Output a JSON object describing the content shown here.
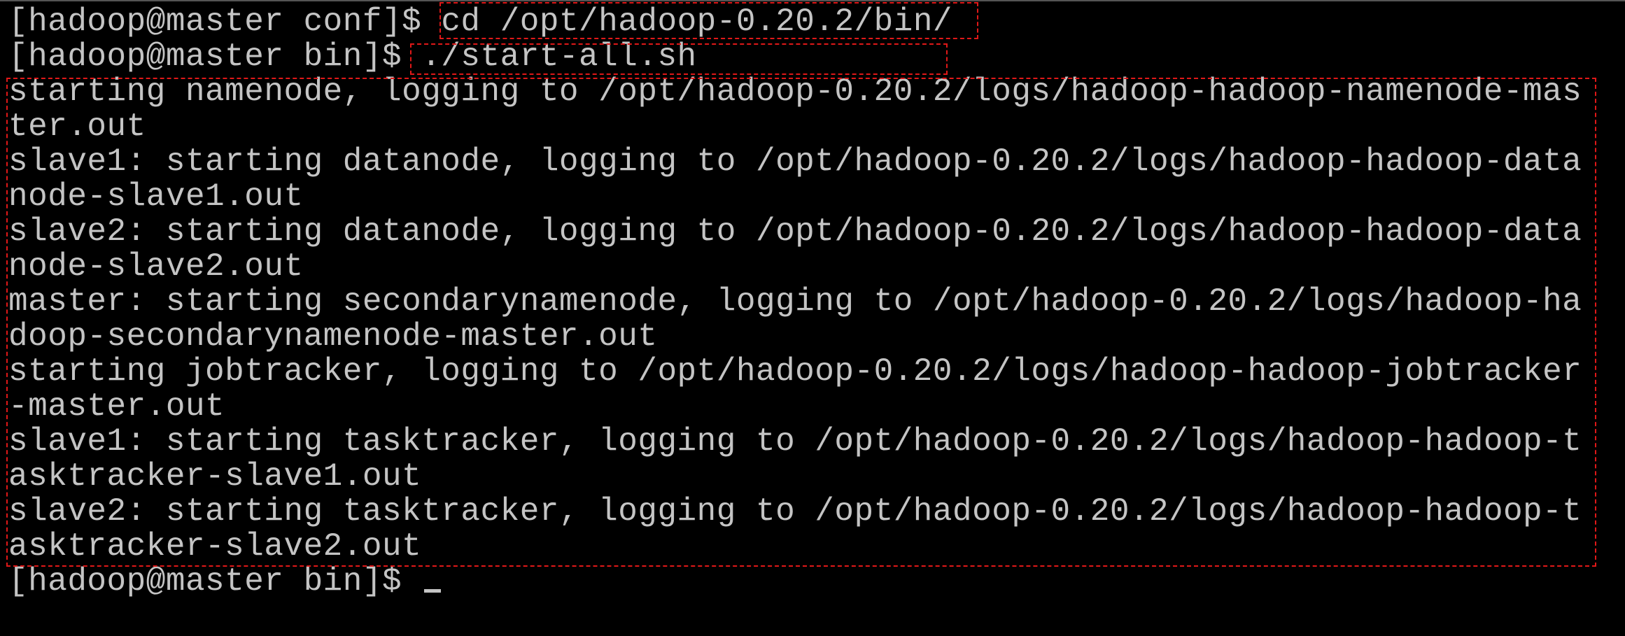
{
  "terminal": {
    "lines": [
      {
        "prompt": "[hadoop@master conf]$ ",
        "command": "cd /opt/hadoop-0.20.2/bin/"
      },
      {
        "prompt": "[hadoop@master bin]$ ",
        "command": "./start-all.sh"
      }
    ],
    "output": [
      "starting namenode, logging to /opt/hadoop-0.20.2/logs/hadoop-hadoop-namenode-mas",
      "ter.out",
      "slave1: starting datanode, logging to /opt/hadoop-0.20.2/logs/hadoop-hadoop-data",
      "node-slave1.out",
      "slave2: starting datanode, logging to /opt/hadoop-0.20.2/logs/hadoop-hadoop-data",
      "node-slave2.out",
      "master: starting secondarynamenode, logging to /opt/hadoop-0.20.2/logs/hadoop-ha",
      "doop-secondarynamenode-master.out",
      "starting jobtracker, logging to /opt/hadoop-0.20.2/logs/hadoop-hadoop-jobtracker",
      "-master.out",
      "slave1: starting tasktracker, logging to /opt/hadoop-0.20.2/logs/hadoop-hadoop-t",
      "asktracker-slave1.out",
      "slave2: starting tasktracker, logging to /opt/hadoop-0.20.2/logs/hadoop-hadoop-t",
      "asktracker-slave2.out"
    ],
    "final_prompt": "[hadoop@master bin]$ "
  },
  "colors": {
    "background": "#000000",
    "text": "#c4c4c4",
    "highlight_box": "#e01818"
  }
}
